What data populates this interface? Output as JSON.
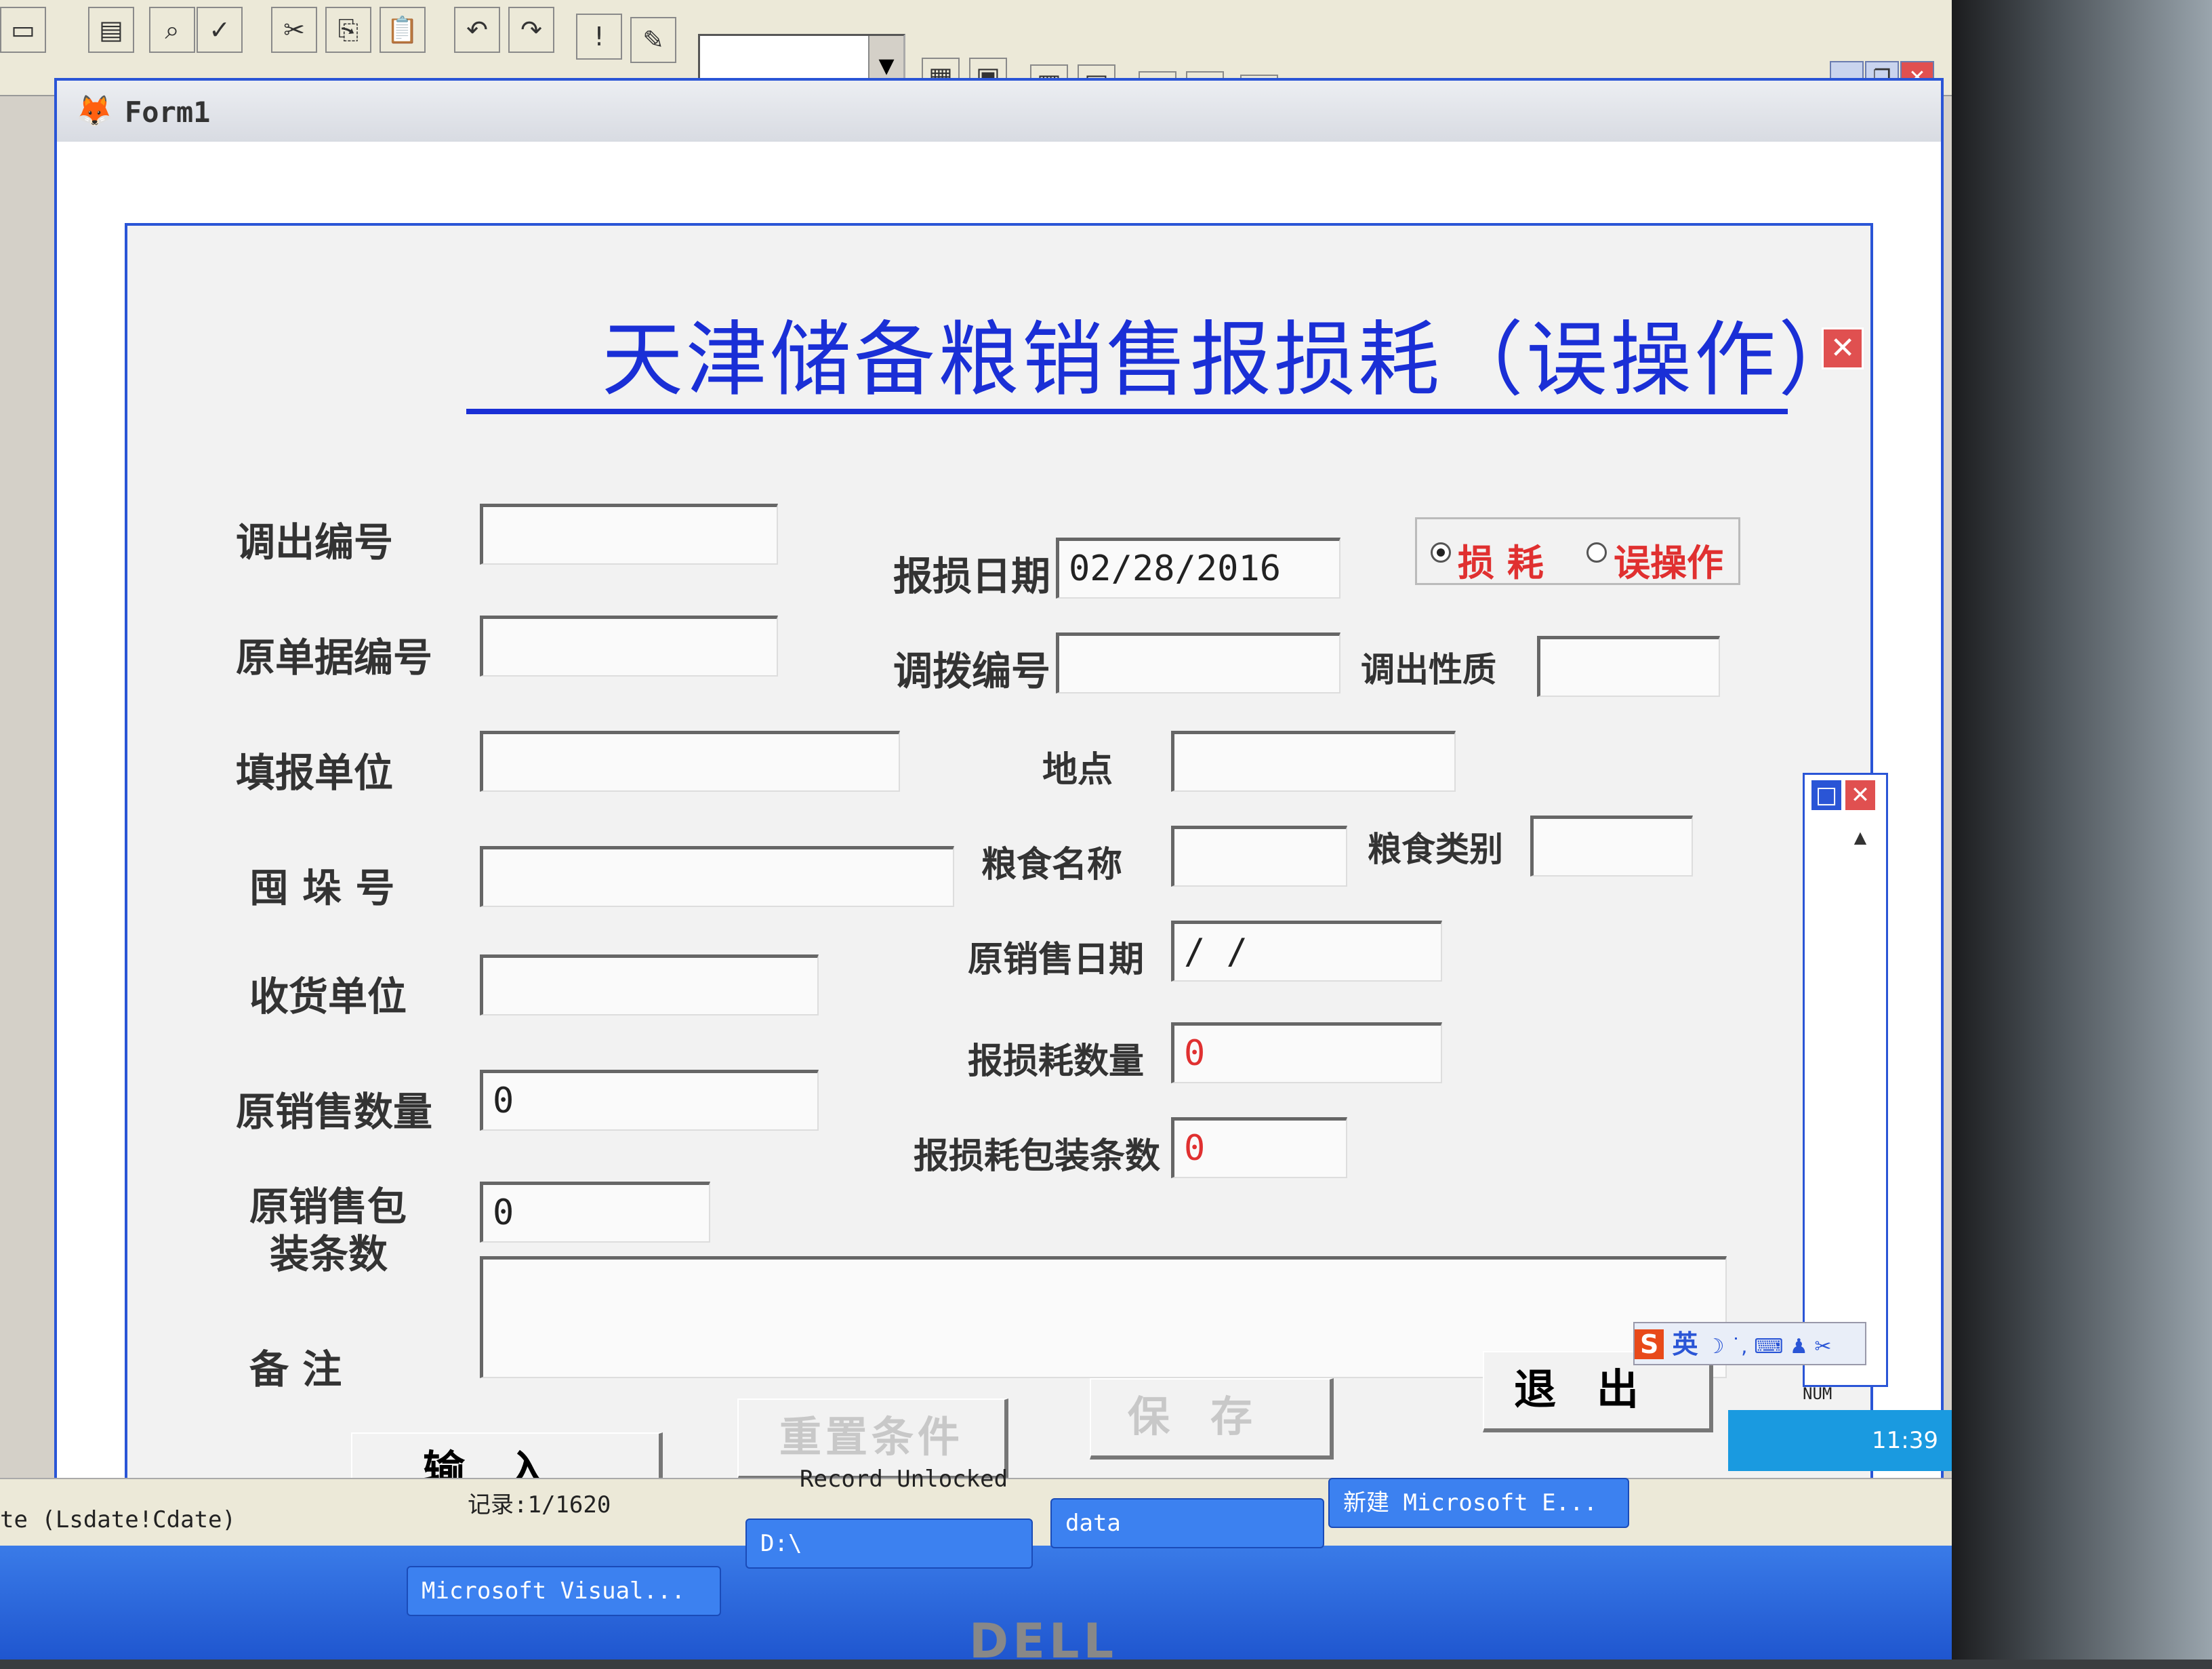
{
  "toolbar": {
    "icons": [
      "new-icon",
      "open-icon",
      "preview-icon",
      "check-icon",
      "cut-icon",
      "copy-icon",
      "paste-icon",
      "undo-icon",
      "redo-icon",
      "run-icon",
      "modify-icon"
    ],
    "combo_value": "",
    "right_icons": [
      "grid-icon",
      "form-icon",
      "builder-icon",
      "report-icon",
      "data-icon",
      "edit-icon",
      "help-icon"
    ],
    "help_glyph": "?"
  },
  "window": {
    "title": "Form1",
    "controls": [
      "_",
      "❐",
      "✕"
    ]
  },
  "form": {
    "title": "天津储备粮销售报损耗（误操作）",
    "close_glyph": "✕",
    "labels": {
      "diaochu_bianhao": "调出编号",
      "baosun_riqi": "报损日期",
      "yuan_danju_bianhao": "原单据编号",
      "diaobo_bianhao": "调拨编号",
      "diaochu_xingzhi": "调出性质",
      "tianbao_danwei": "填报单位",
      "didian": "地点",
      "weiduo_hao": "囤 垛 号",
      "liangshi_mingcheng": "粮食名称",
      "liangshi_leibie": "粮食类别",
      "shouhuo_danwei": "收货单位",
      "yuan_xiaoshou_riqi": "原销售日期",
      "yuan_xiaoshou_shuliang": "原销售数量",
      "baosunhao_shuliang": "报损耗数量",
      "yuan_xiaoshou_baozhuang_1": "原销售包",
      "yuan_xiaoshou_baozhuang_2": "装条数",
      "baosunhao_baozhuang": "报损耗包装条数",
      "beizhu": "备   注"
    },
    "values": {
      "diaochu_bianhao": "",
      "baosun_riqi": "02/28/2016",
      "yuan_danju_bianhao": "",
      "diaobo_bianhao": "",
      "diaochu_xingzhi": "",
      "tianbao_danwei": "",
      "didian": "",
      "weiduo_hao": "",
      "liangshi_mingcheng": "",
      "liangshi_leibie": "",
      "shouhuo_danwei": "",
      "yuan_xiaoshou_riqi": "  /  /",
      "yuan_xiaoshou_shuliang": "0",
      "baosunhao_shuliang": "0",
      "yuan_xiaoshou_baozhuang": "0",
      "baosunhao_baozhuang": "0",
      "beizhu": ""
    },
    "options": {
      "sunhao": "损  耗",
      "wucaozuo": "误操作",
      "selected": "sunhao"
    },
    "buttons": {
      "input": "输入",
      "reset": "重置条件",
      "save": "保存",
      "exit": "退出"
    }
  },
  "side_panel": {
    "controls": [
      "□",
      "✕"
    ],
    "scroll_glyph": "▲"
  },
  "ime": {
    "logo": "S",
    "mode": "英",
    "icons": "☽ ˙, ⌨ ♟ ✂"
  },
  "status": {
    "left": "te (Lsdate!Cdate)",
    "record": "记录:1/1620",
    "lock": "Record Unlocked",
    "num": "NUM"
  },
  "taskbar": {
    "tasks": [
      "Microsoft Visual...",
      "D:\\",
      "data",
      "新建 Microsoft E..."
    ],
    "clock": "11:39"
  },
  "monitor": {
    "brand": "DELL"
  }
}
